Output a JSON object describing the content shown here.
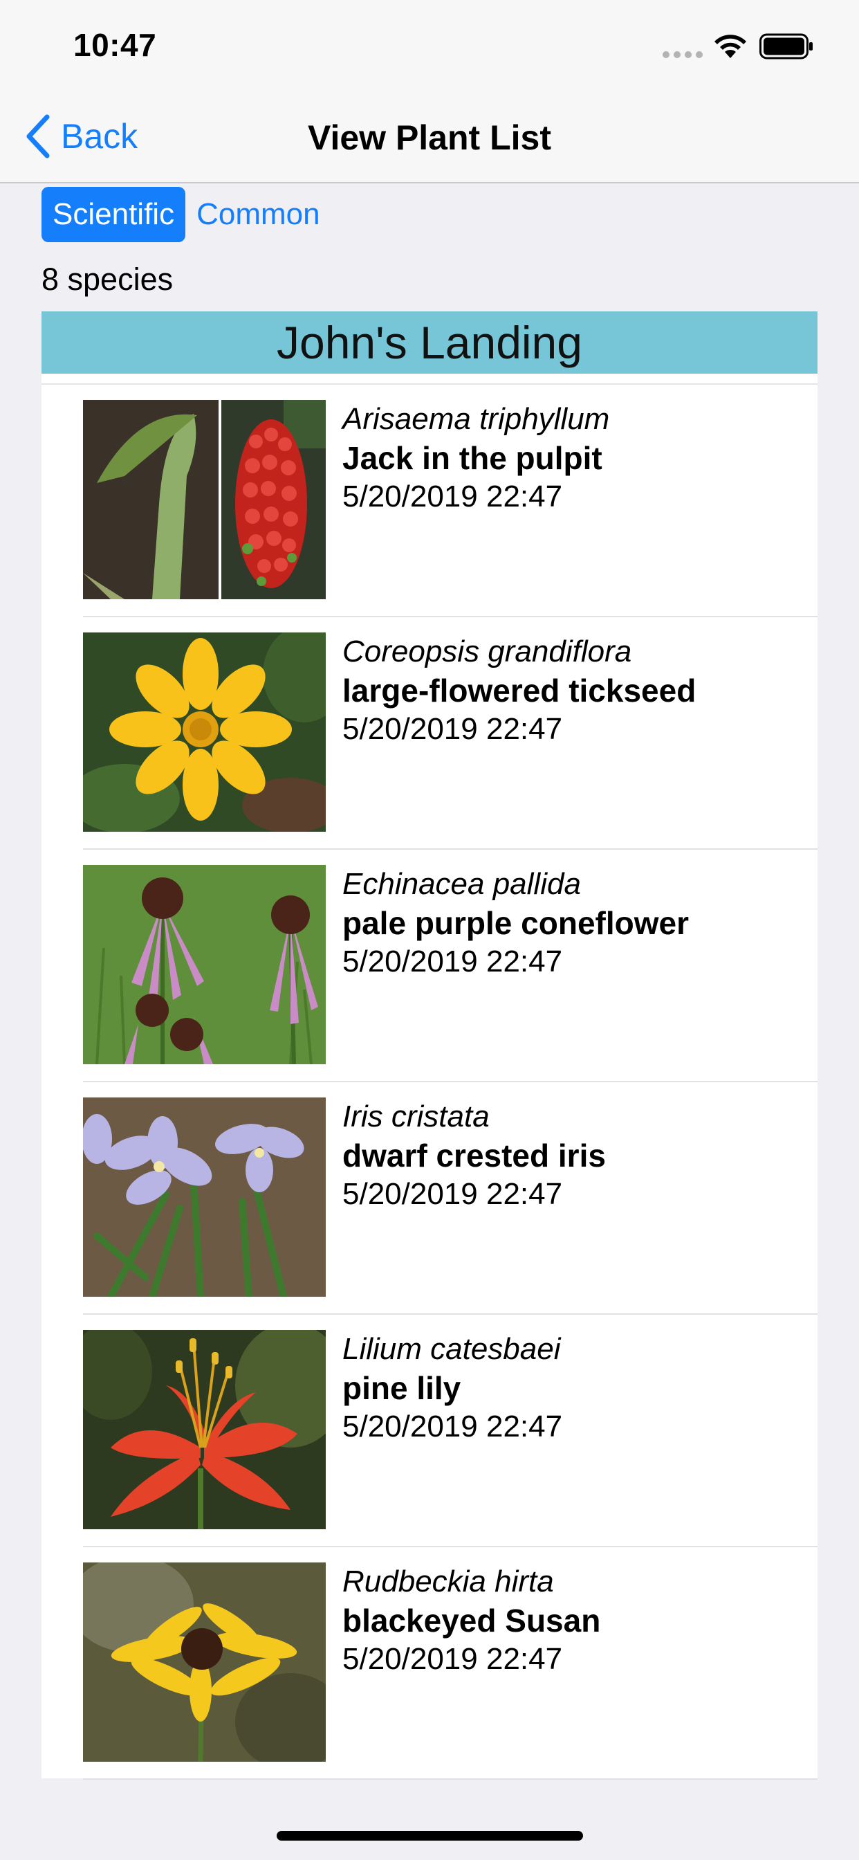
{
  "status_bar": {
    "time": "10:47"
  },
  "nav": {
    "back_label": "Back",
    "title": "View Plant List"
  },
  "segments": [
    {
      "label": "Scientific",
      "selected": true
    },
    {
      "label": "Common",
      "selected": false
    }
  ],
  "species_count": "8 species",
  "section": {
    "title": "John's Landing"
  },
  "colors": {
    "accent": "#147efb",
    "section_header": "#76c6d7",
    "background": "#efeff4"
  },
  "plants": [
    {
      "scientific": "Arisaema triphyllum",
      "common": "Jack in the pulpit",
      "date": "5/20/2019 22:47",
      "icon": "jack-in-the-pulpit-photo"
    },
    {
      "scientific": "Coreopsis grandiflora",
      "common": "large-flowered tickseed",
      "date": "5/20/2019 22:47",
      "icon": "tickseed-photo"
    },
    {
      "scientific": "Echinacea pallida",
      "common": "pale purple coneflower",
      "date": "5/20/2019 22:47",
      "icon": "coneflower-photo"
    },
    {
      "scientific": "Iris cristata",
      "common": "dwarf crested iris",
      "date": "5/20/2019 22:47",
      "icon": "iris-photo"
    },
    {
      "scientific": "Lilium catesbaei",
      "common": "pine lily",
      "date": "5/20/2019 22:47",
      "icon": "pine-lily-photo"
    },
    {
      "scientific": "Rudbeckia hirta",
      "common": "blackeyed Susan",
      "date": "5/20/2019 22:47",
      "icon": "blackeyed-susan-photo"
    }
  ]
}
